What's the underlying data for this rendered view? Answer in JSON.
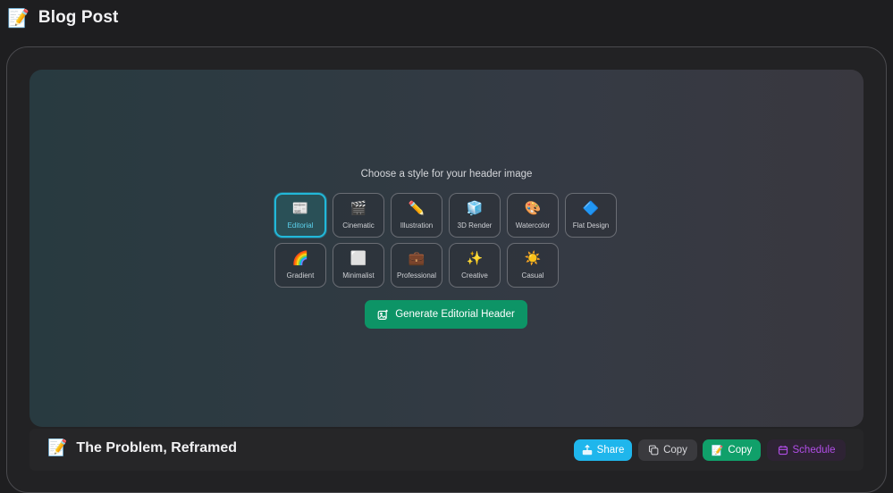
{
  "page": {
    "emoji": "📝",
    "title": "Blog Post"
  },
  "hero": {
    "prompt": "Choose a style for your header image",
    "styles": [
      {
        "icon": "📰",
        "label": "Editorial",
        "selected": true
      },
      {
        "icon": "🎬",
        "label": "Cinematic"
      },
      {
        "icon": "✏️",
        "label": "Illustration"
      },
      {
        "icon": "🧊",
        "label": "3D Render"
      },
      {
        "icon": "🎨",
        "label": "Watercolor"
      },
      {
        "icon": "🔷",
        "label": "Flat Design"
      },
      {
        "icon": "🌈",
        "label": "Gradient"
      },
      {
        "icon": "⬜",
        "label": "Minimalist"
      },
      {
        "icon": "💼",
        "label": "Professional"
      },
      {
        "icon": "✨",
        "label": "Creative"
      },
      {
        "icon": "☀️",
        "label": "Casual"
      }
    ],
    "generate_label": "Generate Editorial Header"
  },
  "footer": {
    "emoji": "📝",
    "title": "The Problem, Reframed",
    "share_label": "Share",
    "copy_label": "Copy",
    "copy2_emoji": "📝",
    "copy2_label": "Copy",
    "schedule_label": "Schedule"
  },
  "colors": {
    "accent_cyan": "#22b8d9",
    "generate_green": "#0d9466",
    "share_blue": "#1fb6ec",
    "copy_green": "#10a06a",
    "schedule_purple": "#b24ee8"
  }
}
